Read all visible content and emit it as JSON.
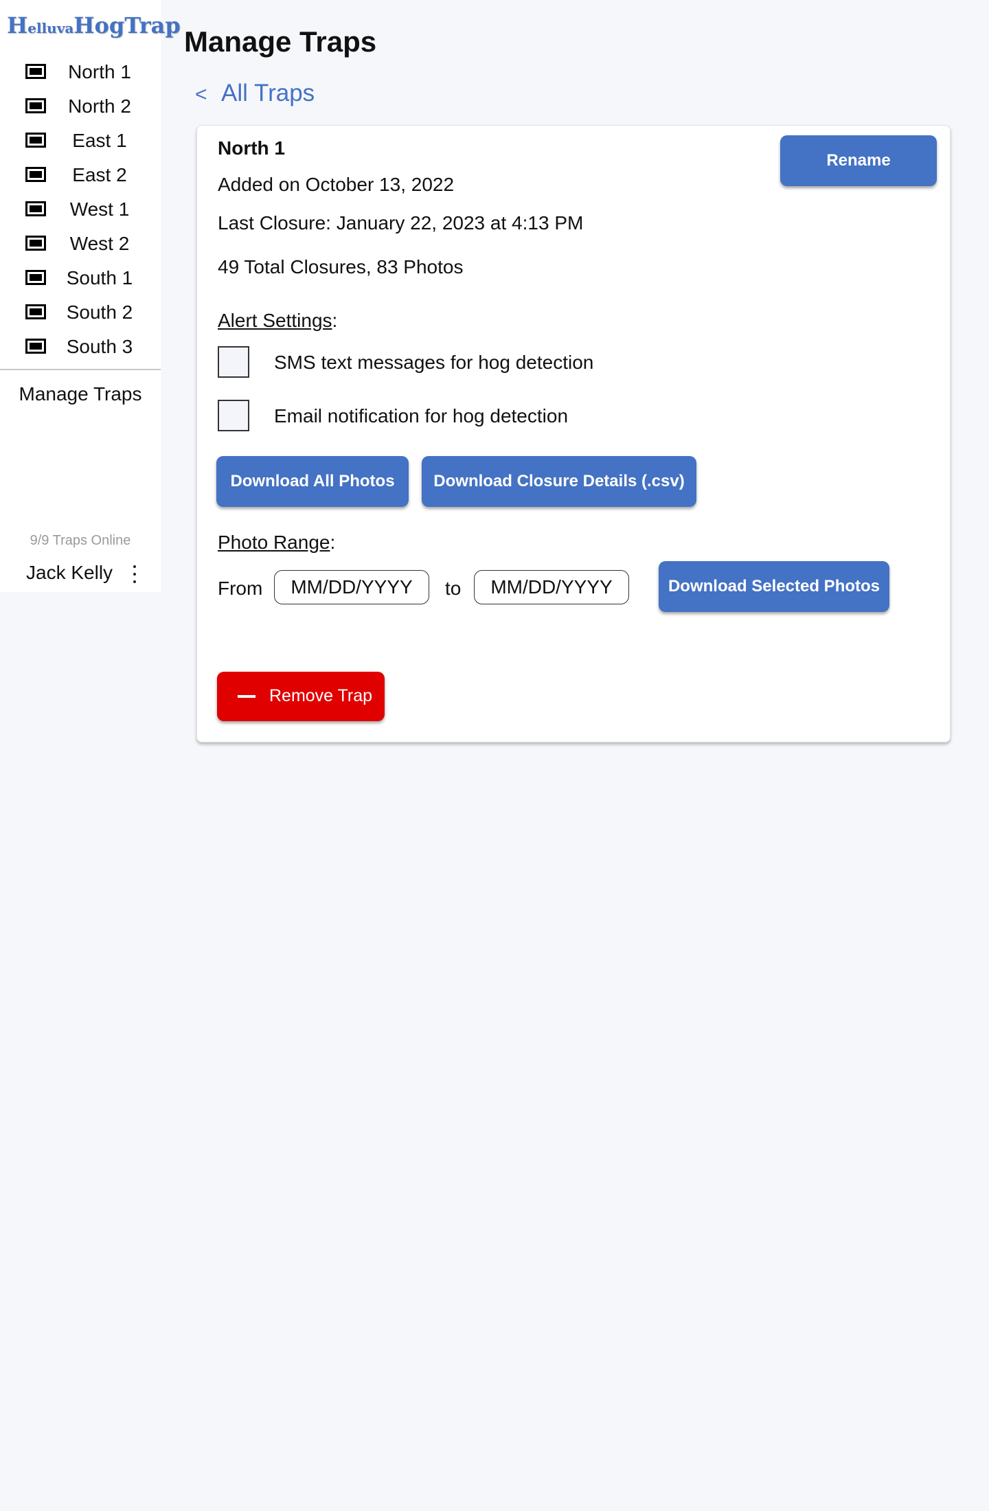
{
  "logo": {
    "h": "H",
    "elluva": "elluva",
    "hog_h": "H",
    "hog_rest": "og",
    "trap_t": "T",
    "trap_rest": "rap"
  },
  "sidebar": {
    "traps": [
      {
        "label": "North 1",
        "icon": "trap-icon"
      },
      {
        "label": "North 2",
        "icon": "trap-icon"
      },
      {
        "label": "East 1",
        "icon": "trap-icon"
      },
      {
        "label": "East 2",
        "icon": "trap-icon"
      },
      {
        "label": "West 1",
        "icon": "trap-icon"
      },
      {
        "label": "West 2",
        "icon": "trap-icon"
      },
      {
        "label": "South 1",
        "icon": "trap-icon"
      },
      {
        "label": "South 2",
        "icon": "trap-icon"
      },
      {
        "label": "South 3",
        "icon": "trap-icon"
      }
    ],
    "manage_label": "Manage Traps",
    "online_status": "9/9 Traps Online",
    "user_name": "Jack Kelly",
    "menu_icon": "kebab-menu-icon"
  },
  "main": {
    "title": "Manage Traps",
    "back_chevron": "<",
    "back_label": "All Traps"
  },
  "trap": {
    "name": "North 1",
    "added": "Added on October 13, 2022",
    "last_closure": "Last Closure: January 22, 2023 at 4:13 PM",
    "totals": "49 Total Closures, 83 Photos",
    "rename_label": "Rename"
  },
  "alerts": {
    "heading": "Alert Settings",
    "colon": ":",
    "sms_label": "SMS text messages for hog detection",
    "email_label": "Email notification for hog detection",
    "sms_checked": false,
    "email_checked": false
  },
  "downloads": {
    "all_photos_label": "Download All Photos",
    "closure_details_label": "Download Closure Details (.csv)"
  },
  "photo_range": {
    "heading": "Photo Range",
    "colon": ":",
    "from_label": "From",
    "to_label": "to",
    "from_placeholder": "MM/DD/YYYY",
    "to_placeholder": "MM/DD/YYYY",
    "from_value": "",
    "to_value": "",
    "download_label": "Download Selected Photos"
  },
  "remove": {
    "label": "Remove Trap",
    "icon": "minus-icon"
  },
  "colors": {
    "accent": "#4472c4",
    "danger": "#e00000",
    "background": "#f6f7fb"
  }
}
